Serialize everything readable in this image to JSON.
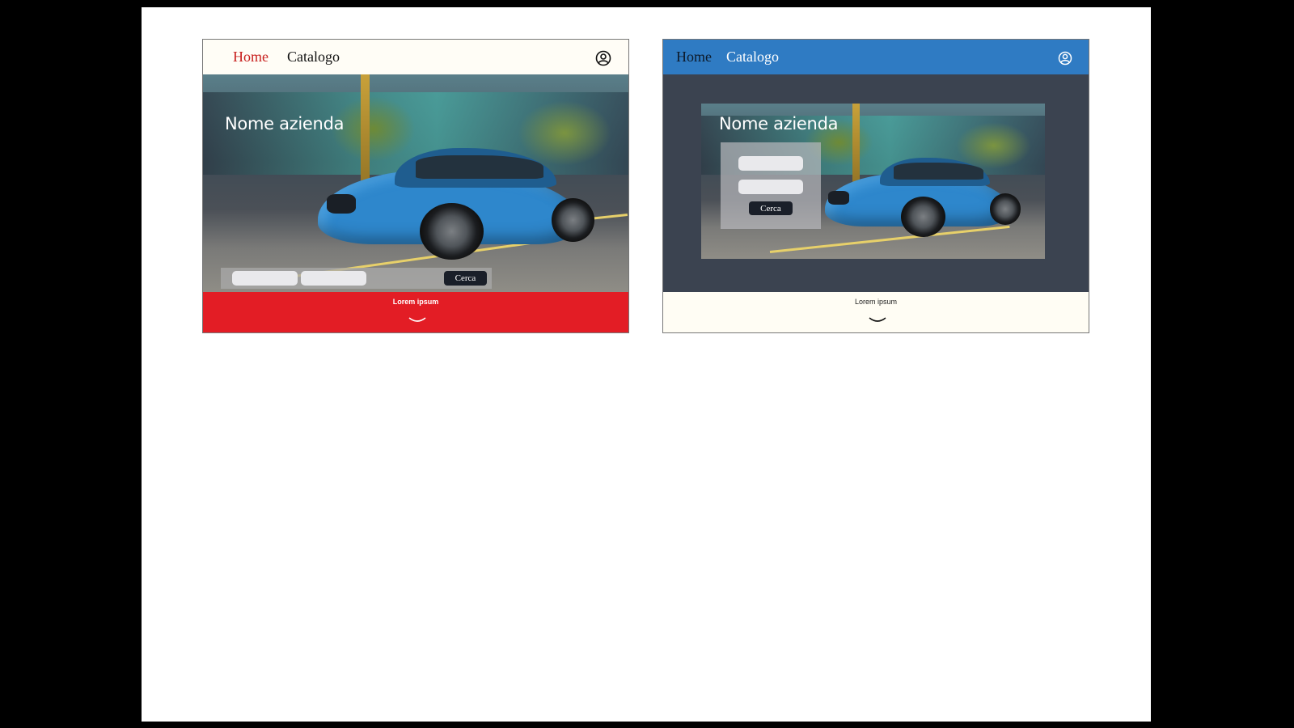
{
  "mockups": [
    {
      "nav": {
        "home": "Home",
        "catalog": "Catalogo",
        "user_icon": "user-circle-icon"
      },
      "hero": {
        "company_name": "Nome azienda",
        "search_button": "Cerca"
      },
      "footer": {
        "text": "Lorem ipsum",
        "chevron_icon": "chevron-down-icon"
      },
      "colors": {
        "nav_bg": "#fffdf6",
        "active_link": "#c8201e",
        "footer_bg": "#e31d25"
      }
    },
    {
      "nav": {
        "home": "Home",
        "catalog": "Catalogo",
        "user_icon": "user-circle-icon"
      },
      "hero": {
        "company_name": "Nome azienda",
        "search_button": "Cerca"
      },
      "footer": {
        "text": "Lorem ipsum",
        "chevron_icon": "chevron-down-icon"
      },
      "colors": {
        "nav_bg": "#2f7bc3",
        "hero_bg": "#3b4350",
        "footer_bg": "#fffdf4"
      }
    }
  ]
}
